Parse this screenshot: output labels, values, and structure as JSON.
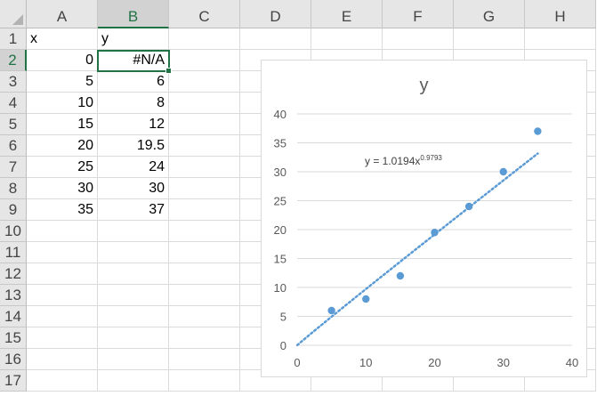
{
  "columns": [
    "A",
    "B",
    "C",
    "D",
    "E",
    "F",
    "G",
    "H"
  ],
  "rows": [
    "1",
    "2",
    "3",
    "4",
    "5",
    "6",
    "7",
    "8",
    "9",
    "10",
    "11",
    "12",
    "13",
    "14",
    "15",
    "16",
    "17"
  ],
  "cells": {
    "A1": "x",
    "B1": "y",
    "A2": "0",
    "B2": "#N/A",
    "A3": "5",
    "B3": "6",
    "A4": "10",
    "B4": "8",
    "A5": "15",
    "B5": "12",
    "A6": "20",
    "B6": "19.5",
    "A7": "25",
    "B7": "24",
    "A8": "30",
    "B8": "30",
    "A9": "35",
    "B9": "37"
  },
  "selection": {
    "active_cell": "B2"
  },
  "chart": {
    "title": "y",
    "trendline_equation": {
      "prefix": "y = 1.0194x",
      "exponent": "0.9793"
    }
  },
  "chart_data": {
    "type": "scatter",
    "title": "y",
    "series": [
      {
        "name": "y",
        "x": [
          5,
          10,
          15,
          20,
          25,
          30,
          35
        ],
        "y": [
          6,
          8,
          12,
          19.5,
          24,
          30,
          37
        ],
        "color": "#5b9bd5"
      }
    ],
    "trendline": {
      "type": "power",
      "a": 1.0194,
      "b": 0.9793,
      "style": "dotted",
      "color": "#5b9bd5"
    },
    "xlim": [
      0,
      40
    ],
    "ylim": [
      0,
      40
    ],
    "x_ticks": [
      "0",
      "10",
      "20",
      "30",
      "40"
    ],
    "y_ticks": [
      "0",
      "5",
      "10",
      "15",
      "20",
      "25",
      "30",
      "35",
      "40"
    ],
    "grid": "horizontal",
    "legend": "none"
  },
  "colors": {
    "accent": "#217346",
    "series": "#5b9bd5",
    "gridline": "#d9d9d9"
  }
}
